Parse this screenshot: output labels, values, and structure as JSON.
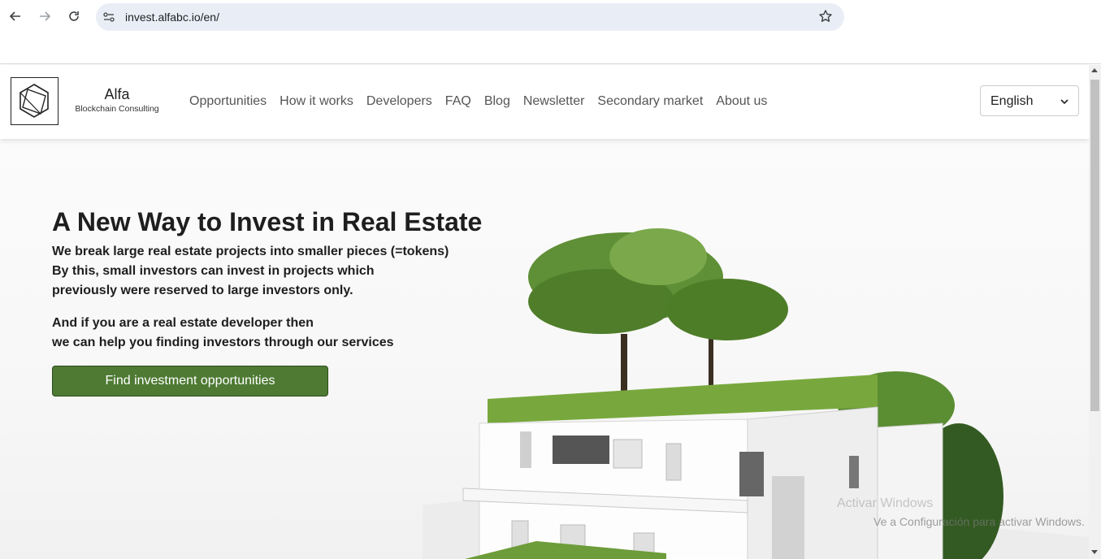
{
  "browser": {
    "url": "invest.alfabc.io/en/",
    "back_icon": "arrow-left",
    "forward_icon": "arrow-right",
    "reload_icon": "reload",
    "site_info_icon": "tune",
    "bookmark_icon": "star"
  },
  "header": {
    "brand_name": "Alfa",
    "brand_sub": "Blockchain Consulting",
    "nav": [
      "Opportunities",
      "How it works",
      "Developers",
      "FAQ",
      "Blog",
      "Newsletter",
      "Secondary market",
      "About us"
    ],
    "language": "English"
  },
  "hero": {
    "title": "A New Way to Invest in Real Estate",
    "line1": "We break large real estate projects into smaller pieces (=tokens)",
    "line2": "By this, small investors can invest in projects which",
    "line3": "previously were reserved to large investors only.",
    "line4": "And if you are a real estate developer then",
    "line5": "we can help you finding investors through our services",
    "cta": "Find investment opportunities"
  },
  "overlay": {
    "activate_title": "Activar Windows",
    "activate_text": "Ve a Configuración para activar Windows."
  },
  "colors": {
    "cta_bg": "#4e7a33",
    "omnibox_bg": "#e9eef6"
  }
}
